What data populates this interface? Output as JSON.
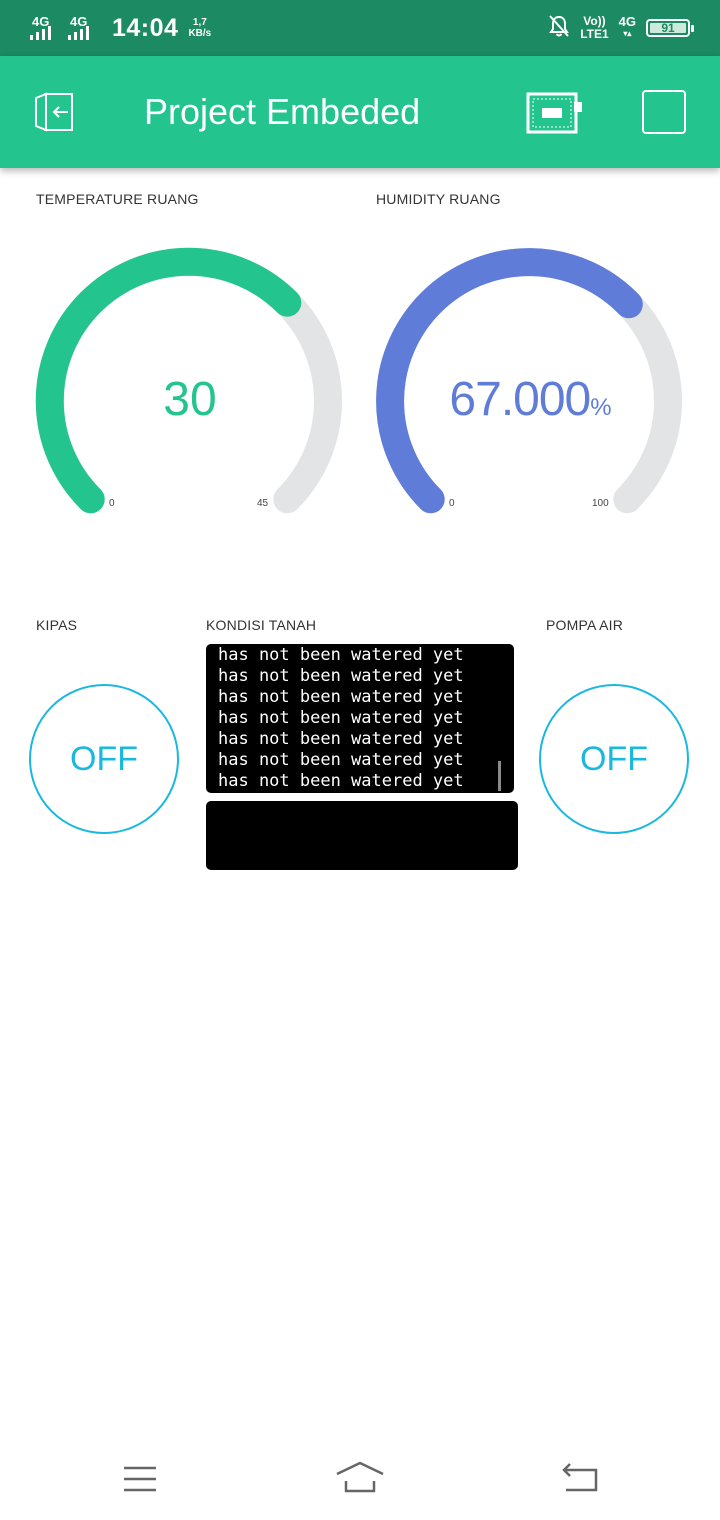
{
  "status_bar": {
    "sim1_label": "4G",
    "sim2_label": "4G",
    "time": "14:04",
    "speed_value": "1,7",
    "speed_unit": "KB/s",
    "volte_top": "Vo))",
    "volte_bottom": "LTE1",
    "data_type": "4G",
    "battery": "91",
    "icons": [
      "signal-icon",
      "signal-icon",
      "bell-muted-icon",
      "battery-icon"
    ]
  },
  "app_bar": {
    "title": "Project Embeded",
    "icons": [
      "exit-icon",
      "device-board-icon",
      "square-icon"
    ],
    "color": "#23c48e"
  },
  "temperature": {
    "label": "TEMPERATURE RUANG",
    "value": "30",
    "min": "0",
    "max": "45",
    "level": 0.6667,
    "color": "#23c48e"
  },
  "humidity": {
    "label": "HUMIDITY RUANG",
    "value": "67.000",
    "unit": "%",
    "min": "0",
    "max": "100",
    "level": 0.67,
    "color": "#5f7cd8"
  },
  "kipas": {
    "label": "KIPAS",
    "state": "OFF"
  },
  "kondisi_tanah": {
    "label": "KONDISI TANAH",
    "lines": [
      "has not been watered yet",
      "has not been watered yet",
      "has not been watered yet",
      "has not been watered yet",
      "has not been watered yet",
      "has not been watered yet",
      "has not been watered yet"
    ],
    "input_value": ""
  },
  "pompa_air": {
    "label": "POMPA AIR",
    "state": "OFF"
  },
  "nav": {
    "icons": [
      "menu-icon",
      "home-icon",
      "back-icon"
    ]
  },
  "colors": {
    "status_bar": "#1c8a63",
    "button_outline": "#1ab8e0",
    "track": "#e3e4e6"
  }
}
